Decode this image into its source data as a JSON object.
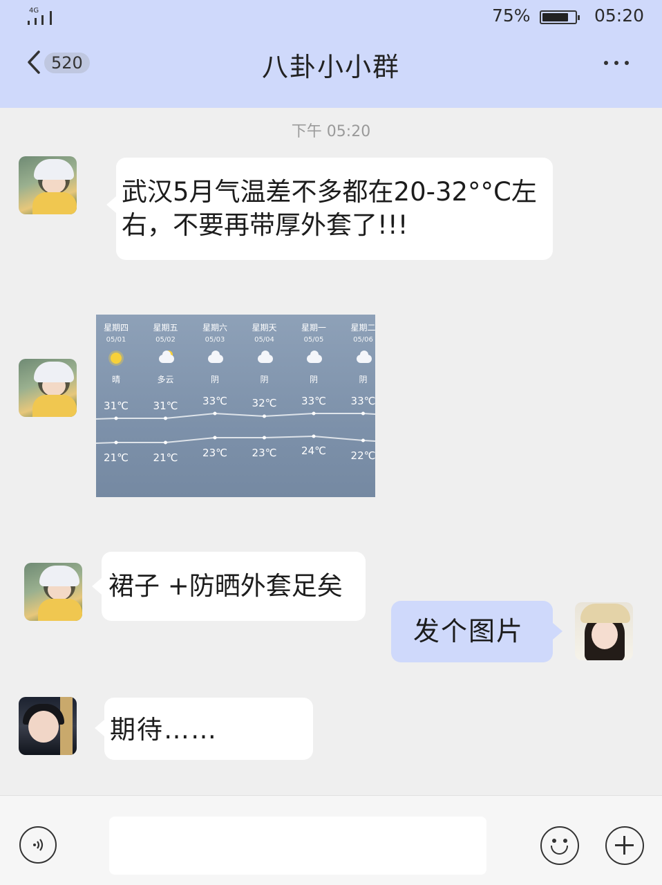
{
  "status_bar": {
    "network": "4G",
    "battery_percent": "75%",
    "battery_level": 0.75,
    "time": "05:20"
  },
  "nav": {
    "unread_count": "520",
    "title": "八卦小小群"
  },
  "chat": {
    "timestamp": "下午 05:20",
    "messages": [
      {
        "side": "left",
        "text": "武汉5月气温差不多都在20-32°°C左右，不要再带厚外套了!!!"
      },
      {
        "side": "left",
        "type": "image"
      },
      {
        "side": "left",
        "text": "裙子 +防晒外套足矣"
      },
      {
        "side": "right",
        "text": "发个图片"
      },
      {
        "side": "left",
        "text": "期待……"
      }
    ]
  },
  "weather_forecast": {
    "days": [
      {
        "day": "星期四",
        "date": "05/01",
        "icon": "sun-icon",
        "condition": "晴",
        "high": "31℃",
        "low": "21℃"
      },
      {
        "day": "星期五",
        "date": "05/02",
        "icon": "partly-cloudy-icon",
        "condition": "多云",
        "high": "31℃",
        "low": "21℃"
      },
      {
        "day": "星期六",
        "date": "05/03",
        "icon": "cloud-icon",
        "condition": "阴",
        "high": "33℃",
        "low": "23℃"
      },
      {
        "day": "星期天",
        "date": "05/04",
        "icon": "cloud-icon",
        "condition": "阴",
        "high": "32℃",
        "low": "23℃"
      },
      {
        "day": "星期一",
        "date": "05/05",
        "icon": "cloud-icon",
        "condition": "阴",
        "high": "33℃",
        "low": "24℃"
      },
      {
        "day": "星期二",
        "date": "05/06",
        "icon": "cloud-icon",
        "condition": "阴",
        "high": "33℃",
        "low": "22℃"
      }
    ]
  },
  "footer": {
    "input_value": ""
  },
  "colors": {
    "header_bg": "#cfd9fb",
    "chat_bg": "#efefef",
    "bubble_left": "#ffffff",
    "bubble_right": "#cfd9fb"
  }
}
